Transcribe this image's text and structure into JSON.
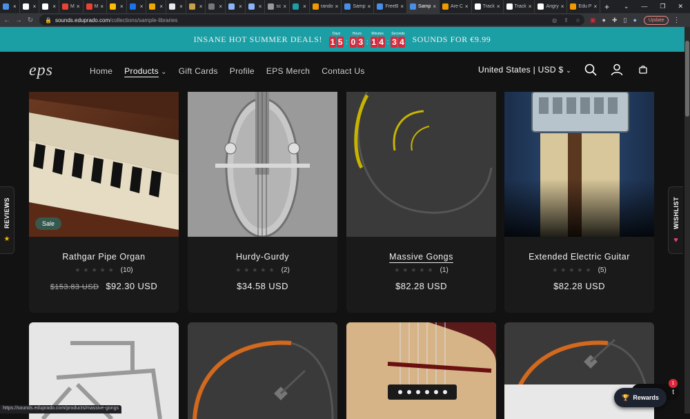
{
  "browser": {
    "tabs": [
      {
        "label": "",
        "color": "#4a8fe7"
      },
      {
        "label": "",
        "color": "#ffffff"
      },
      {
        "label": "",
        "color": "#ffffff"
      },
      {
        "label": "M",
        "color": "#ea4335"
      },
      {
        "label": "M",
        "color": "#ea4335"
      },
      {
        "label": "",
        "color": "#fbbc04"
      },
      {
        "label": "",
        "color": "#1a73e8"
      },
      {
        "label": "",
        "color": "#f2a600"
      },
      {
        "label": "",
        "color": "#e8eaed"
      },
      {
        "label": "",
        "color": "#c8a24a"
      },
      {
        "label": "",
        "color": "#777777"
      },
      {
        "label": "",
        "color": "#8ab4f8"
      },
      {
        "label": "",
        "color": "#8ab4f8"
      },
      {
        "label": "sc",
        "color": "#999999"
      },
      {
        "label": "",
        "color": "#1b9ea4"
      },
      {
        "label": "rando",
        "color": "#f29900"
      },
      {
        "label": "Samp",
        "color": "#4a8fe7"
      },
      {
        "label": "FreeB",
        "color": "#4a8fe7"
      },
      {
        "label": "Samp",
        "color": "#4a8fe7"
      },
      {
        "label": "Are C",
        "color": "#f29900"
      },
      {
        "label": "Track",
        "color": "#ffffff"
      },
      {
        "label": "Track",
        "color": "#ffffff"
      },
      {
        "label": "Angry",
        "color": "#ffffff"
      },
      {
        "label": "Edu P",
        "color": "#f29900"
      }
    ],
    "active_tab_index": 18,
    "url_host": "sounds.eduprado.com",
    "url_path": "/collections/sample-libraries",
    "update_label": "Update",
    "status_url": "https://sounds.eduprado.com/products/massive-gongs"
  },
  "promo": {
    "left_text": "INSANE HOT SUMMER DEALS!",
    "right_text": "SOUNDS FOR €9.99",
    "countdown": [
      {
        "label": "Days",
        "digits": [
          "1",
          "5"
        ]
      },
      {
        "label": "Hours",
        "digits": [
          "0",
          "3"
        ]
      },
      {
        "label": "Minutes",
        "digits": [
          "1",
          "4"
        ]
      },
      {
        "label": "Seconds",
        "digits": [
          "3",
          "4"
        ]
      }
    ]
  },
  "header": {
    "logo": "eps",
    "nav": [
      "Home",
      "Products",
      "Gift Cards",
      "Profile",
      "EPS Merch",
      "Contact Us"
    ],
    "active_nav": "Products",
    "locale": "United States | USD $"
  },
  "products": [
    {
      "title": "Rathgar Pipe Organ",
      "reviews": "(10)",
      "old_price": "$153.83 USD",
      "price": "$92.30 USD",
      "badge": "Sale"
    },
    {
      "title": "Hurdy-Gurdy",
      "reviews": "(2)",
      "old_price": "",
      "price": "$34.58 USD",
      "badge": ""
    },
    {
      "title": "Massive Gongs",
      "reviews": "(1)",
      "old_price": "",
      "price": "$82.28 USD",
      "badge": ""
    },
    {
      "title": "Extended Electric Guitar",
      "reviews": "(5)",
      "old_price": "",
      "price": "$82.28 USD",
      "badge": ""
    }
  ],
  "side": {
    "reviews_label": "REVIEWS",
    "wishlist_label": "WISHLIST"
  },
  "widgets": {
    "chat_label": "t",
    "rewards_label": "Rewards",
    "notif_count": "1"
  },
  "colors": {
    "promo_bg": "#1b9ea4",
    "digit_bg": "#d9283a",
    "sale_badge": "#36584d",
    "page_bg": "#121212"
  }
}
